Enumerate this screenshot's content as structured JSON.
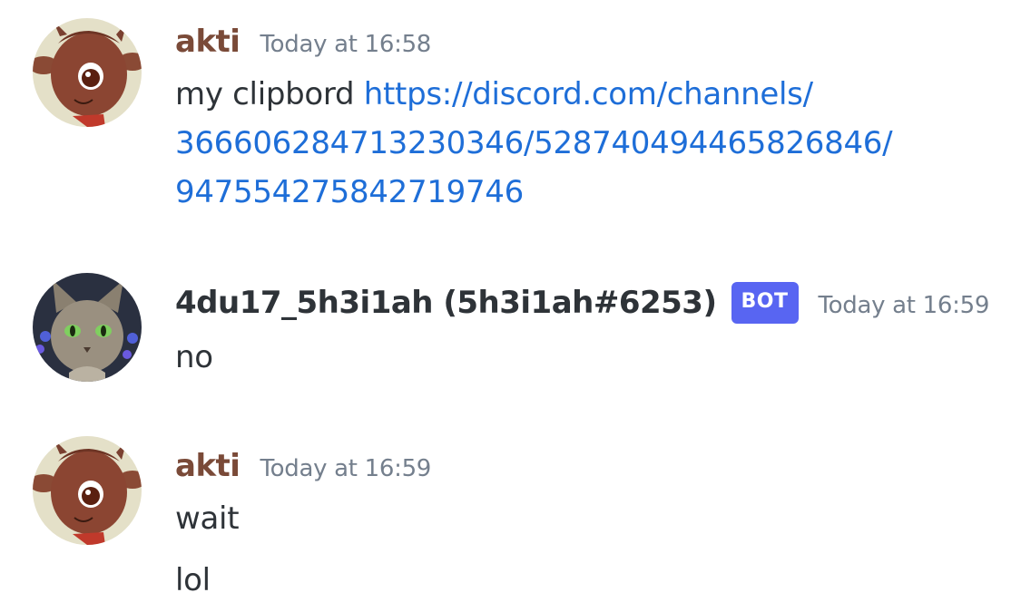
{
  "messages": [
    {
      "author": "akti",
      "author_color": "#7a4a38",
      "timestamp": "Today at 16:58",
      "avatar": "deer-character-avatar-icon",
      "content": {
        "prefix": "my clipbord ",
        "link_line1": "https://discord.com/channels/",
        "link_line2": "366606284713230346/528740494465826846/",
        "link_line3": "947554275842719746"
      }
    },
    {
      "author": "4du17_5h3i1ah (5h3i1ah#6253)",
      "author_color": "#2e3338",
      "bot_tag": "BOT",
      "timestamp": "Today at 16:59",
      "avatar": "cat-character-avatar-icon",
      "content": {
        "text": "no"
      }
    },
    {
      "author": "akti",
      "author_color": "#7a4a38",
      "timestamp": "Today at 16:59",
      "avatar": "deer-character-avatar-icon",
      "content": {
        "line1": "wait",
        "line2": "lol"
      }
    }
  ]
}
